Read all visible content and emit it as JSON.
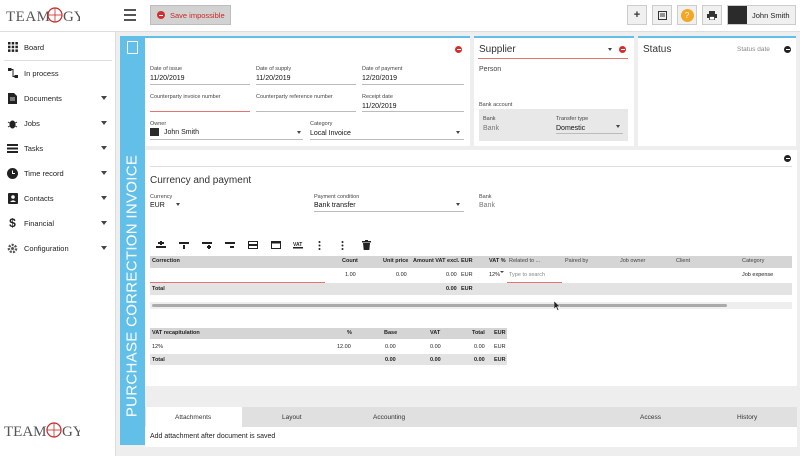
{
  "app": {
    "logo_text": "TEAMOGY"
  },
  "toolbar": {
    "save_label": "Save impossible",
    "user_name": "John Smith"
  },
  "sidebar": {
    "items": [
      {
        "label": "Board",
        "icon": "grid-icon"
      },
      {
        "label": "In process",
        "icon": "workflow-icon"
      },
      {
        "label": "Documents",
        "icon": "document-icon"
      },
      {
        "label": "Jobs",
        "icon": "bug-icon"
      },
      {
        "label": "Tasks",
        "icon": "tasks-icon"
      },
      {
        "label": "Time record",
        "icon": "clock-icon"
      },
      {
        "label": "Contacts",
        "icon": "contacts-icon"
      },
      {
        "label": "Financial",
        "icon": "dollar-icon"
      },
      {
        "label": "Configuration",
        "icon": "gear-icon"
      }
    ]
  },
  "document": {
    "type_label": "PURCHASE CORRECTION INVOICE"
  },
  "dates": {
    "issue_label": "Date of issue",
    "issue_value": "11/20/2019",
    "supply_label": "Date of supply",
    "supply_value": "11/20/2019",
    "payment_label": "Date of payment",
    "payment_value": "12/20/2019",
    "cp_invoice_label": "Counterparty invoice number",
    "cp_reference_label": "Counterparty reference number",
    "receipt_label": "Receipt date",
    "receipt_value": "11/20/2019",
    "owner_label": "Owner",
    "owner_value": "John Smith",
    "category_label": "Category",
    "category_value": "Local Invoice"
  },
  "supplier": {
    "title": "Supplier",
    "person_label": "Person",
    "bank_account_label": "Bank account",
    "bank_label": "Bank",
    "bank_placeholder": "Bank",
    "transfer_label": "Transfer type",
    "transfer_value": "Domestic"
  },
  "status": {
    "title": "Status",
    "date_label": "Status date"
  },
  "currency": {
    "section_title": "Currency and payment",
    "currency_label": "Currency",
    "currency_value": "EUR",
    "condition_label": "Payment condition",
    "condition_value": "Bank transfer",
    "bank_label": "Bank",
    "bank_value": "Bank"
  },
  "correction_table": {
    "headers": [
      "Correction",
      "Count",
      "Unit price",
      "Amount VAT excl.",
      "EUR",
      "VAT %",
      "Related to ...",
      "Paired by",
      "Job owner",
      "Client",
      "Category"
    ],
    "row": {
      "count": "1.00",
      "unit_price": "0.00",
      "amount": "0.00",
      "currency": "EUR",
      "vat": "12%",
      "related_placeholder": "Type to search",
      "category": "Job expense"
    },
    "total": {
      "label": "Total",
      "amount": "0.00",
      "currency": "EUR"
    }
  },
  "vat_table": {
    "headers": [
      "VAT recapitulation",
      "%",
      "Base",
      "VAT",
      "Total",
      "EUR"
    ],
    "row": [
      "12%",
      "12.00",
      "0.00",
      "0.00",
      "0.00",
      "EUR"
    ],
    "total": [
      "Total",
      "0.00",
      "0.00",
      "0.00",
      "EUR"
    ]
  },
  "tabs": {
    "attachments": "Attachments",
    "layout": "Layout",
    "accounting": "Accounting",
    "access": "Access",
    "history": "History"
  },
  "attachments_message": "Add attachment after document is saved",
  "colors": {
    "accent": "#62c0e8",
    "danger": "#d32f2f",
    "help": "#f5a623"
  }
}
